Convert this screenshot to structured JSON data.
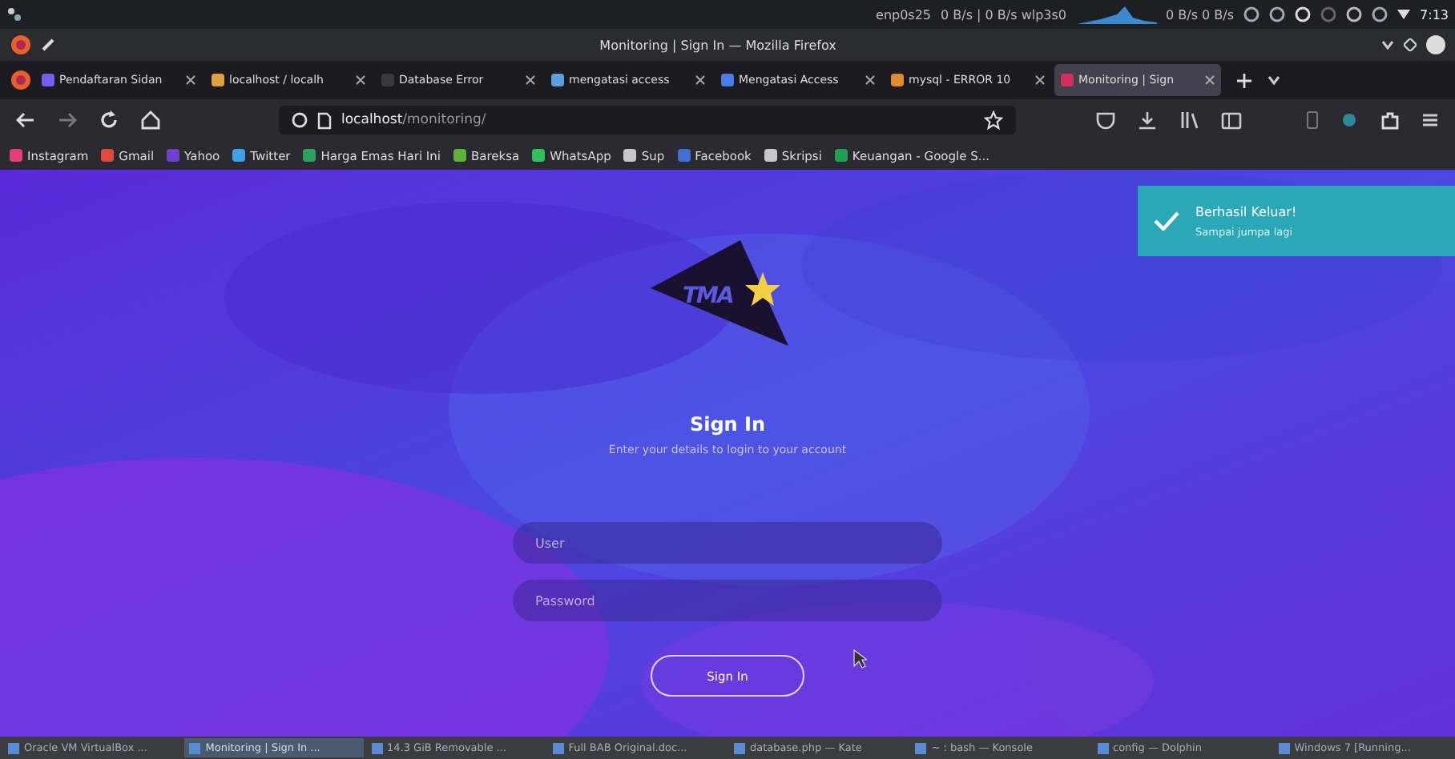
{
  "top_panel": {
    "network_label": "enp0s25",
    "network_rate": "0 B/s | 0 B/s wlp3s0",
    "graph_rate": "0 B/s 0 B/s",
    "clock": "7:13"
  },
  "window": {
    "title": "Monitoring | Sign In — Mozilla Firefox"
  },
  "tabs": [
    {
      "label": "Pendaftaran Sidan",
      "selected": false,
      "color": "#7b5cf0"
    },
    {
      "label": "localhost / localh",
      "selected": false,
      "color": "#e0a040"
    },
    {
      "label": "Database Error",
      "selected": false,
      "color": "#3a3a3e"
    },
    {
      "label": "mengatasi access",
      "selected": false,
      "color": "#5aa0e0"
    },
    {
      "label": "Mengatasi Access",
      "selected": false,
      "color": "#4a7ee8"
    },
    {
      "label": "mysql - ERROR 10",
      "selected": false,
      "color": "#e08a30"
    },
    {
      "label": "Monitoring | Sign",
      "selected": true,
      "color": "#d0305a"
    }
  ],
  "address": {
    "host": "localhost",
    "path": "/monitoring/"
  },
  "bookmarks": [
    {
      "label": "Instagram",
      "color": "#e0407a"
    },
    {
      "label": "Gmail",
      "color": "#e04a3a"
    },
    {
      "label": "Yahoo",
      "color": "#7040d0"
    },
    {
      "label": "Twitter",
      "color": "#40a0e8"
    },
    {
      "label": "Harga Emas Hari Ini",
      "color": "#30a060"
    },
    {
      "label": "Bareksa",
      "color": "#60b040"
    },
    {
      "label": "WhatsApp",
      "color": "#30c060"
    },
    {
      "label": "Sup",
      "color": "#c8c8c8"
    },
    {
      "label": "Facebook",
      "color": "#4070d0"
    },
    {
      "label": "Skripsi",
      "color": "#c8c8c8"
    },
    {
      "label": "Keuangan - Google S...",
      "color": "#20a050"
    }
  ],
  "page": {
    "logo_text": "TMA",
    "heading": "Sign In",
    "subheading": "Enter your details to login to your account",
    "user_placeholder": "User",
    "password_placeholder": "Password",
    "button": "Sign In"
  },
  "toast": {
    "title": "Berhasil Keluar!",
    "message": "Sampai jumpa lagi"
  },
  "taskbar": [
    {
      "label": "Oracle VM VirtualBox ...",
      "selected": false
    },
    {
      "label": "Monitoring | Sign In ...",
      "selected": true
    },
    {
      "label": "14.3 GiB Removable ...",
      "selected": false
    },
    {
      "label": "Full BAB Original.doc...",
      "selected": false
    },
    {
      "label": "database.php — Kate",
      "selected": false
    },
    {
      "label": "~ : bash — Konsole",
      "selected": false
    },
    {
      "label": "config — Dolphin",
      "selected": false
    },
    {
      "label": "Windows 7 [Running...",
      "selected": false
    }
  ]
}
